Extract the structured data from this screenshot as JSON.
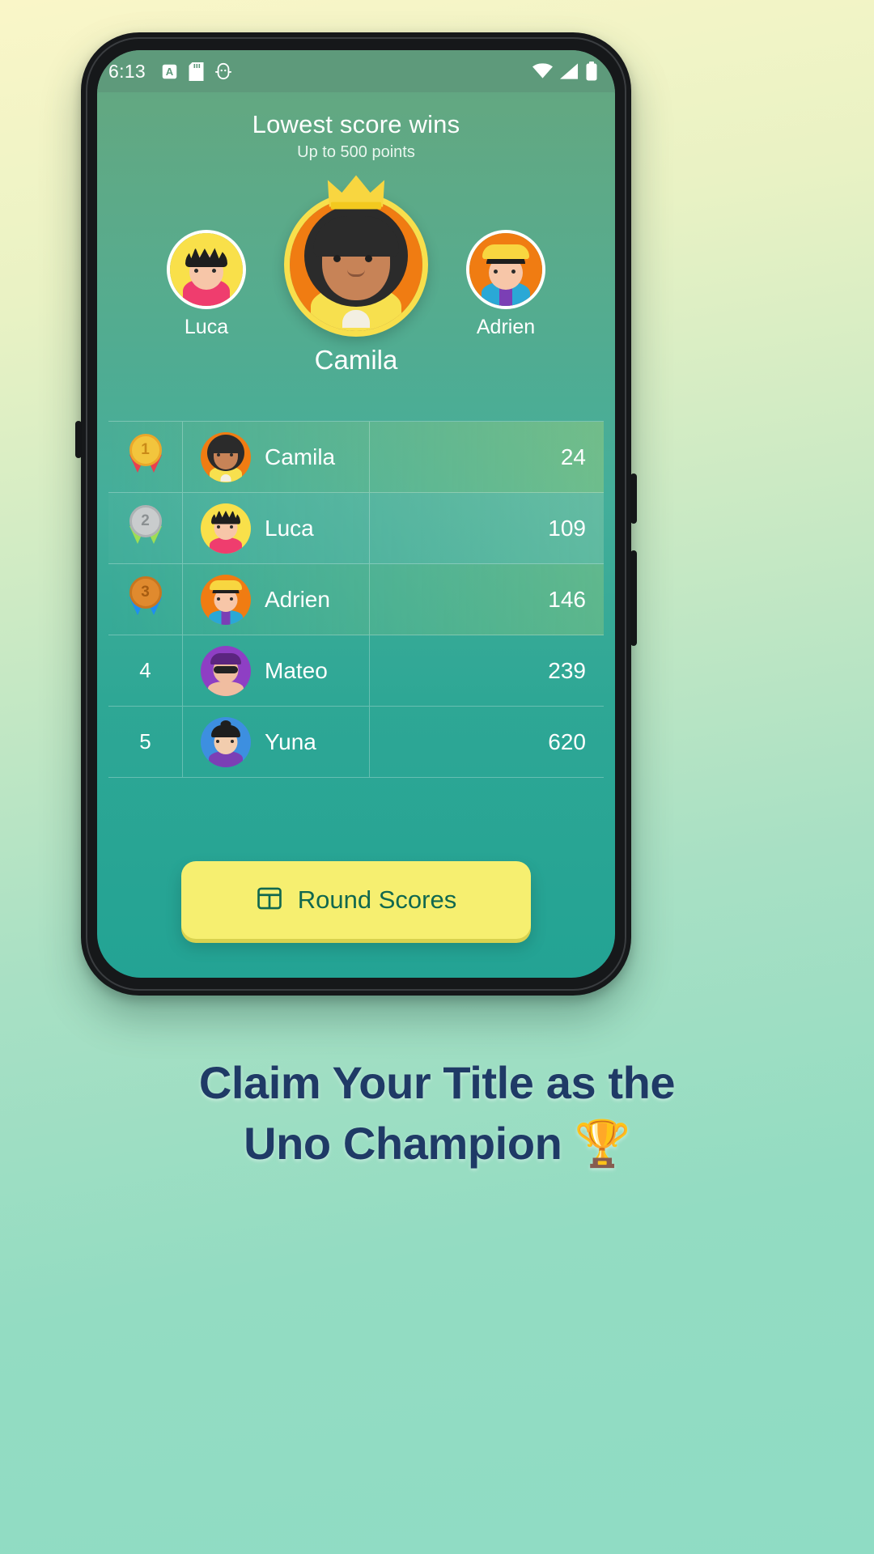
{
  "status_bar": {
    "time": "6:13",
    "left_icons": [
      "silent-mode-icon",
      "sd-card-icon",
      "android-debug-icon"
    ],
    "right_icons": [
      "wifi-icon",
      "cellular-signal-icon",
      "battery-icon"
    ]
  },
  "header": {
    "title": "Lowest score wins",
    "subtitle": "Up to 500 points"
  },
  "podium": {
    "left": {
      "name": "Luca",
      "place": 2
    },
    "center": {
      "name": "Camila",
      "place": 1,
      "crown": "crown-icon"
    },
    "right": {
      "name": "Adrien",
      "place": 3
    }
  },
  "leaderboard": {
    "rows": [
      {
        "rank": "1",
        "medal": "gold",
        "name": "Camila",
        "score": "24"
      },
      {
        "rank": "2",
        "medal": "silver",
        "name": "Luca",
        "score": "109"
      },
      {
        "rank": "3",
        "medal": "bronze",
        "name": "Adrien",
        "score": "146"
      },
      {
        "rank": "4",
        "medal": "",
        "name": "Mateo",
        "score": "239"
      },
      {
        "rank": "5",
        "medal": "",
        "name": "Yuna",
        "score": "620"
      }
    ]
  },
  "bottom_button": {
    "label": "Round Scores",
    "icon": "table-grid-icon"
  },
  "caption": {
    "line1": "Claim Your Title as the",
    "line2": "Uno Champion 🏆"
  },
  "colors": {
    "screen_top": "#63a280",
    "screen_bottom": "#23a394",
    "status_bar": "#5e9a7b",
    "button_yellow": "#f6ef70",
    "button_text": "#11684f",
    "caption_navy": "#1f3a66",
    "crown_gold": "#f8d640",
    "gold_medal": "#f2c53d",
    "silver_medal": "#c9ccce",
    "bronze_medal": "#e08a2e"
  }
}
